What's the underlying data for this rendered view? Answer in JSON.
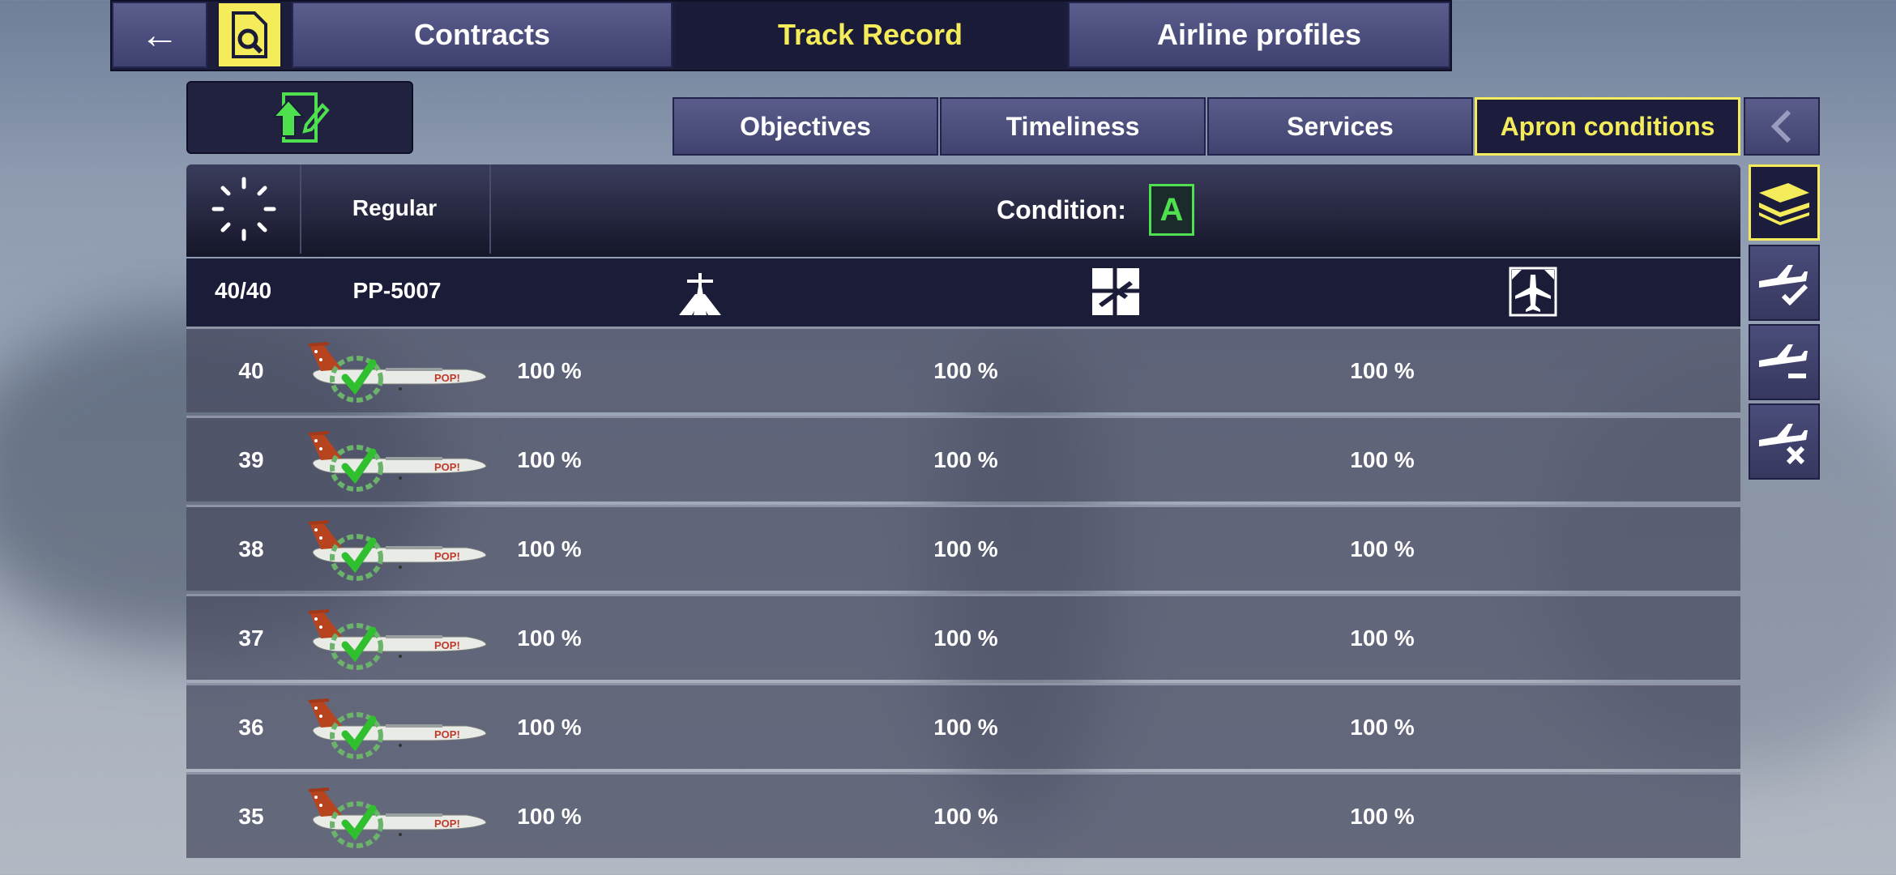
{
  "top_tabs": {
    "back": "←",
    "contracts": "Contracts",
    "track_record": "Track Record",
    "airline_profiles": "Airline profiles"
  },
  "sub_tabs": {
    "objectives": "Objectives",
    "timeliness": "Timeliness",
    "services": "Services",
    "apron": "Apron conditions"
  },
  "header": {
    "type": "Regular",
    "condition_label": "Condition:",
    "condition_grade": "A"
  },
  "columns": {
    "count": "40/40",
    "flight": "PP-5007"
  },
  "rows": [
    {
      "num": "40",
      "a": "100 %",
      "b": "100 %",
      "c": "100 %"
    },
    {
      "num": "39",
      "a": "100 %",
      "b": "100 %",
      "c": "100 %"
    },
    {
      "num": "38",
      "a": "100 %",
      "b": "100 %",
      "c": "100 %"
    },
    {
      "num": "37",
      "a": "100 %",
      "b": "100 %",
      "c": "100 %"
    },
    {
      "num": "36",
      "a": "100 %",
      "b": "100 %",
      "c": "100 %"
    },
    {
      "num": "35",
      "a": "100 %",
      "b": "100 %",
      "c": "100 %"
    }
  ],
  "plane_livery_text": "POP!",
  "colors": {
    "accent": "#f4ec5a",
    "green": "#4ee04e"
  }
}
